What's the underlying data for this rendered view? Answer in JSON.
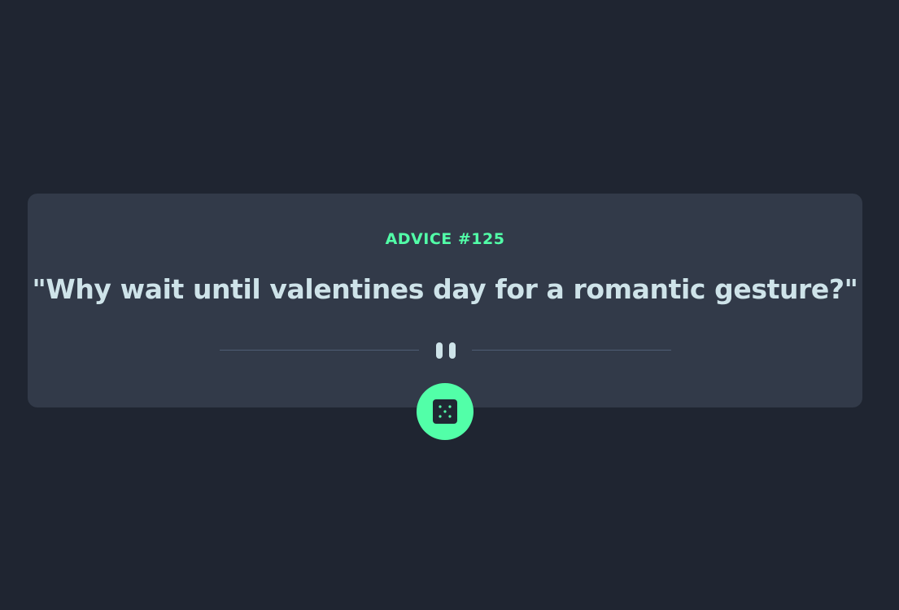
{
  "advice": {
    "label": "ADVICE #125",
    "text": "\"Why wait until valentines day for a romantic gesture?\""
  },
  "divider": {
    "icon": "pause-icon"
  },
  "roll_button": {
    "icon": "dice-icon"
  },
  "colors": {
    "background": "#1f2531",
    "card": "#323a49",
    "accent": "#52ffa8",
    "text": "#cee3e9",
    "divider": "#4f5d74"
  }
}
